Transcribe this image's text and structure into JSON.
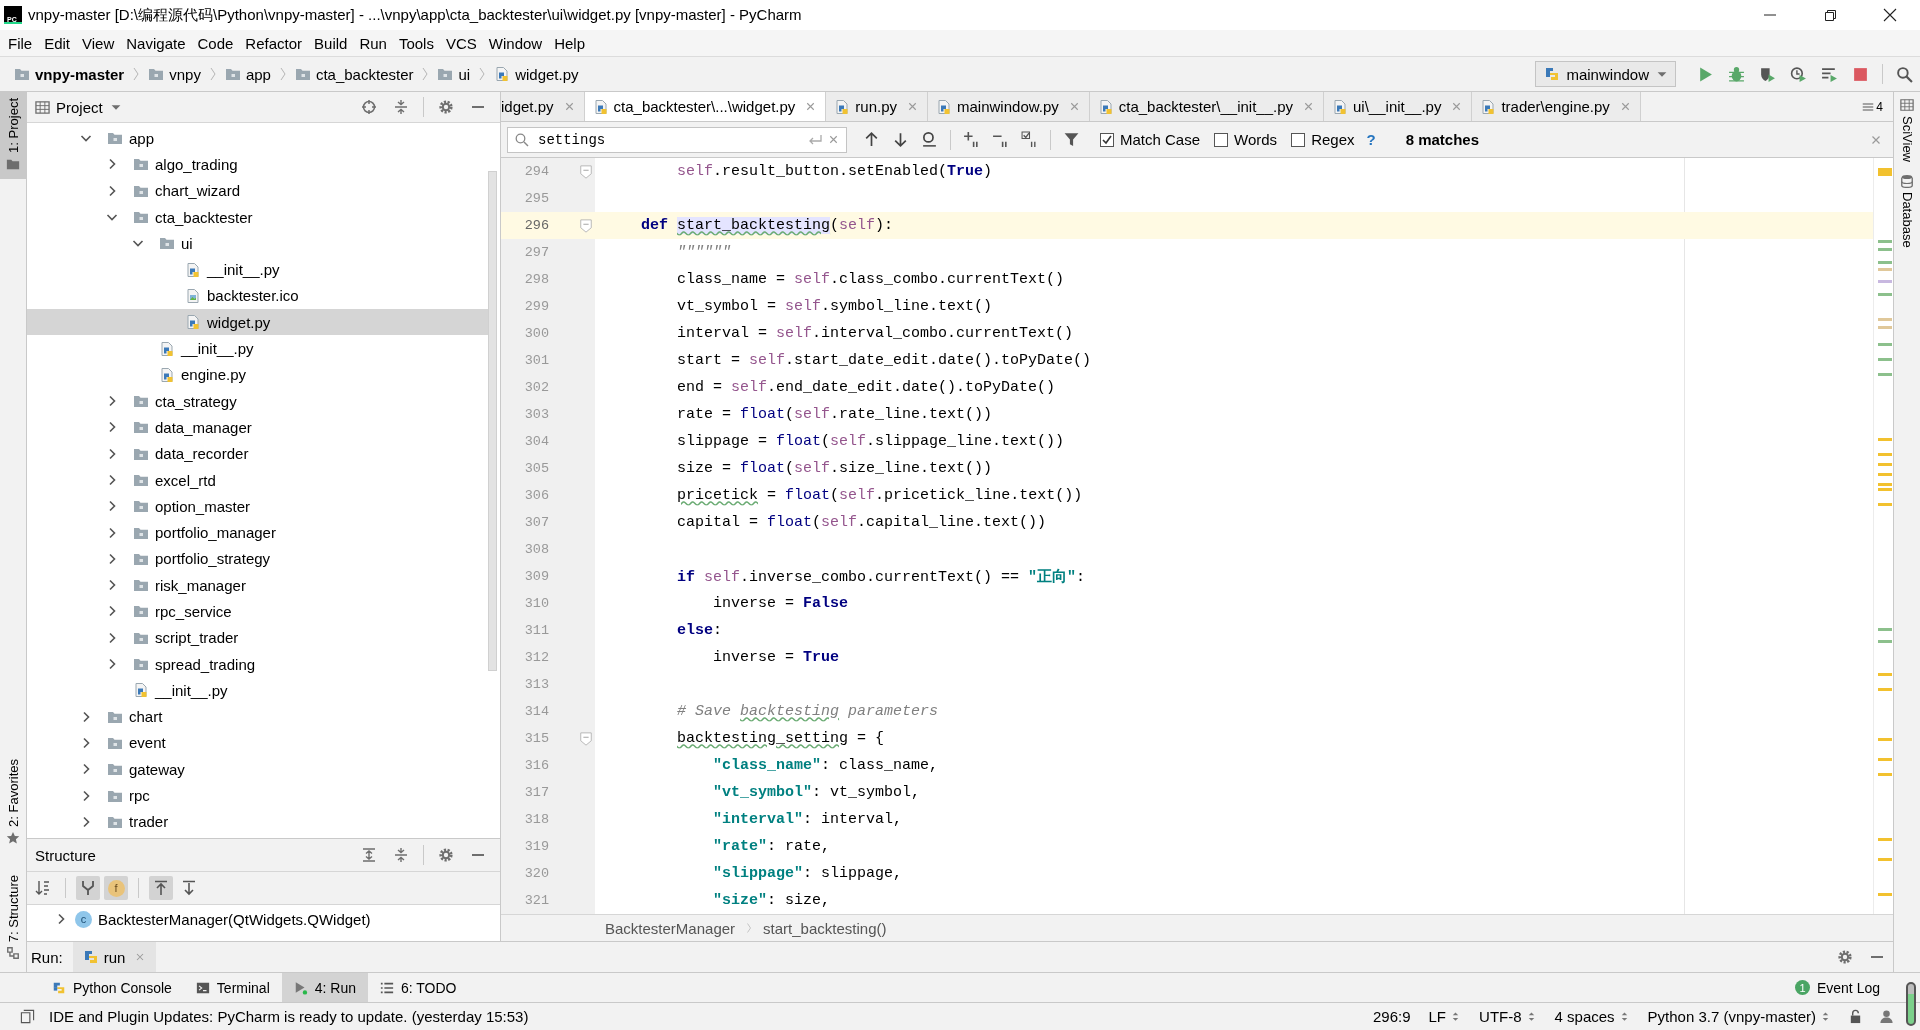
{
  "window": {
    "logo": "PC",
    "title": "vnpy-master [D:\\编程源代码\\Python\\vnpy-master] - ...\\vnpy\\app\\cta_backtester\\ui\\widget.py [vnpy-master] - PyCharm"
  },
  "menu": [
    "File",
    "Edit",
    "View",
    "Navigate",
    "Code",
    "Refactor",
    "Build",
    "Run",
    "Tools",
    "VCS",
    "Window",
    "Help"
  ],
  "breadcrumbs": [
    {
      "label": "vnpy-master",
      "kind": "root"
    },
    {
      "label": "vnpy",
      "kind": "folder"
    },
    {
      "label": "app",
      "kind": "folder"
    },
    {
      "label": "cta_backtester",
      "kind": "folder"
    },
    {
      "label": "ui",
      "kind": "folder"
    },
    {
      "label": "widget.py",
      "kind": "python"
    }
  ],
  "run_config": {
    "label": "mainwindow"
  },
  "left_tool_tabs": [
    {
      "label": "1: Project",
      "kind": "project",
      "selected": true
    },
    {
      "label": "2: Favorites",
      "kind": "favorites",
      "selected": false
    },
    {
      "label": "7: Structure",
      "kind": "structure",
      "selected": false
    }
  ],
  "right_tool_tabs": [
    {
      "label": "SciView",
      "kind": "sciview"
    },
    {
      "label": "Database",
      "kind": "database"
    }
  ],
  "project_panel": {
    "title": "Project",
    "tree": [
      {
        "label": "app",
        "kind": "folder",
        "expanded": true,
        "selected": false,
        "children": [
          {
            "label": "algo_trading",
            "kind": "folder",
            "expanded": false,
            "selected": false
          },
          {
            "label": "chart_wizard",
            "kind": "folder",
            "expanded": false,
            "selected": false
          },
          {
            "label": "cta_backtester",
            "kind": "folder",
            "expanded": true,
            "selected": false,
            "children": [
              {
                "label": "ui",
                "kind": "folder",
                "expanded": true,
                "selected": false,
                "children": [
                  {
                    "label": "__init__.py",
                    "kind": "python",
                    "selected": false
                  },
                  {
                    "label": "backtester.ico",
                    "kind": "image",
                    "selected": false
                  },
                  {
                    "label": "widget.py",
                    "kind": "python",
                    "selected": true
                  }
                ]
              },
              {
                "label": "__init__.py",
                "kind": "python",
                "selected": false
              },
              {
                "label": "engine.py",
                "kind": "python",
                "selected": false
              }
            ]
          },
          {
            "label": "cta_strategy",
            "kind": "folder",
            "expanded": false,
            "selected": false
          },
          {
            "label": "data_manager",
            "kind": "folder",
            "expanded": false,
            "selected": false
          },
          {
            "label": "data_recorder",
            "kind": "folder",
            "expanded": false,
            "selected": false
          },
          {
            "label": "excel_rtd",
            "kind": "folder",
            "expanded": false,
            "selected": false
          },
          {
            "label": "option_master",
            "kind": "folder",
            "expanded": false,
            "selected": false
          },
          {
            "label": "portfolio_manager",
            "kind": "folder",
            "expanded": false,
            "selected": false
          },
          {
            "label": "portfolio_strategy",
            "kind": "folder",
            "expanded": false,
            "selected": false
          },
          {
            "label": "risk_manager",
            "kind": "folder",
            "expanded": false,
            "selected": false
          },
          {
            "label": "rpc_service",
            "kind": "folder",
            "expanded": false,
            "selected": false
          },
          {
            "label": "script_trader",
            "kind": "folder",
            "expanded": false,
            "selected": false
          },
          {
            "label": "spread_trading",
            "kind": "folder",
            "expanded": false,
            "selected": false
          },
          {
            "label": "__init__.py",
            "kind": "python",
            "selected": false
          }
        ]
      },
      {
        "label": "chart",
        "kind": "folder",
        "expanded": false,
        "selected": false
      },
      {
        "label": "event",
        "kind": "folder",
        "expanded": false,
        "selected": false
      },
      {
        "label": "gateway",
        "kind": "folder",
        "expanded": false,
        "selected": false
      },
      {
        "label": "rpc",
        "kind": "folder",
        "expanded": false,
        "selected": false
      },
      {
        "label": "trader",
        "kind": "folder",
        "expanded": false,
        "selected": false
      }
    ]
  },
  "structure_panel": {
    "title": "Structure",
    "toolbar": [
      {
        "kind": "sort",
        "on": false
      },
      {
        "kind": "inherited",
        "on": true
      },
      {
        "kind": "fields",
        "label": "f",
        "on": true
      },
      {
        "kind": "scroll_from",
        "on": true
      },
      {
        "kind": "scroll_to",
        "on": false
      }
    ],
    "items": [
      {
        "label": "BacktesterManager(QtWidgets.QWidget)",
        "badge": "c",
        "expanded": false
      }
    ]
  },
  "editor": {
    "tabs": [
      {
        "label": "idget.py",
        "selected": false
      },
      {
        "label": "cta_backtester\\...\\widget.py",
        "kind": "python",
        "selected": true
      },
      {
        "label": "run.py",
        "kind": "python",
        "selected": false
      },
      {
        "label": "mainwindow.py",
        "kind": "python",
        "selected": false
      },
      {
        "label": "cta_backtester\\__init__.py",
        "kind": "python",
        "selected": false
      },
      {
        "label": "ui\\__init__.py",
        "kind": "python",
        "selected": false
      },
      {
        "label": "trader\\engine.py",
        "kind": "python",
        "selected": false
      }
    ],
    "tab_overflow": "4",
    "find": {
      "value": "settings",
      "options": [
        {
          "label": "Match Case",
          "checked": true
        },
        {
          "label": "Words",
          "checked": false
        },
        {
          "label": "Regex",
          "checked": false
        }
      ],
      "help": "?",
      "matches": "8 matches"
    },
    "lines": [
      {
        "number": "294",
        "current": false,
        "fold": true,
        "tokens": [
          {
            "text": "        self",
            "kind": "self"
          },
          {
            "text": ".result_button.setEnabled(",
            "kind": "t"
          },
          {
            "text": "True",
            "kind": "kw"
          },
          {
            "text": ")",
            "kind": "t"
          }
        ]
      },
      {
        "number": "295",
        "current": false,
        "fold": false
      },
      {
        "number": "296",
        "current": true,
        "fold": true,
        "tokens": [
          {
            "text": "    def ",
            "kind": "kw"
          },
          {
            "text": "start_backtesting",
            "kind": "hl"
          },
          {
            "text": "(",
            "kind": "t"
          },
          {
            "text": "self",
            "kind": "self"
          },
          {
            "text": "):",
            "kind": "t"
          }
        ]
      },
      {
        "number": "297",
        "current": false,
        "fold": false,
        "tokens": [
          {
            "text": "        \"\"\"\"\"\"",
            "kind": "doc"
          }
        ]
      },
      {
        "number": "298",
        "current": false,
        "fold": false,
        "tokens": [
          {
            "text": "        class_name = ",
            "kind": "t"
          },
          {
            "text": "self",
            "kind": "self"
          },
          {
            "text": ".class_combo.currentText()",
            "kind": "t"
          }
        ]
      },
      {
        "number": "299",
        "current": false,
        "fold": false,
        "tokens": [
          {
            "text": "        vt_symbol = ",
            "kind": "t"
          },
          {
            "text": "self",
            "kind": "self"
          },
          {
            "text": ".symbol_line.text()",
            "kind": "t"
          }
        ]
      },
      {
        "number": "300",
        "current": false,
        "fold": false,
        "tokens": [
          {
            "text": "        interval = ",
            "kind": "t"
          },
          {
            "text": "self",
            "kind": "self"
          },
          {
            "text": ".interval_combo.currentText()",
            "kind": "t"
          }
        ]
      },
      {
        "number": "301",
        "current": false,
        "fold": false,
        "tokens": [
          {
            "text": "        start = ",
            "kind": "t"
          },
          {
            "text": "self",
            "kind": "self"
          },
          {
            "text": ".start_date_edit.date().toPyDate()",
            "kind": "t"
          }
        ]
      },
      {
        "number": "302",
        "current": false,
        "fold": false,
        "tokens": [
          {
            "text": "        end = ",
            "kind": "t"
          },
          {
            "text": "self",
            "kind": "self"
          },
          {
            "text": ".end_date_edit.date().toPyDate()",
            "kind": "t"
          }
        ]
      },
      {
        "number": "303",
        "current": false,
        "fold": false,
        "tokens": [
          {
            "text": "        rate = ",
            "kind": "t"
          },
          {
            "text": "float",
            "kind": "bi"
          },
          {
            "text": "(",
            "kind": "t"
          },
          {
            "text": "self",
            "kind": "self"
          },
          {
            "text": ".rate_line.text())",
            "kind": "t"
          }
        ]
      },
      {
        "number": "304",
        "current": false,
        "fold": false,
        "tokens": [
          {
            "text": "        slippage = ",
            "kind": "t"
          },
          {
            "text": "float",
            "kind": "bi"
          },
          {
            "text": "(",
            "kind": "t"
          },
          {
            "text": "self",
            "kind": "self"
          },
          {
            "text": ".slippage_line.text())",
            "kind": "t"
          }
        ]
      },
      {
        "number": "305",
        "current": false,
        "fold": false,
        "tokens": [
          {
            "text": "        size = ",
            "kind": "t"
          },
          {
            "text": "float",
            "kind": "bi"
          },
          {
            "text": "(",
            "kind": "t"
          },
          {
            "text": "self",
            "kind": "self"
          },
          {
            "text": ".size_line.text())",
            "kind": "t"
          }
        ]
      },
      {
        "number": "306",
        "current": false,
        "fold": false,
        "tokens": [
          {
            "text": "        pricetick",
            "kind": "typo"
          },
          {
            "text": " = ",
            "kind": "t"
          },
          {
            "text": "float",
            "kind": "bi"
          },
          {
            "text": "(",
            "kind": "t"
          },
          {
            "text": "self",
            "kind": "self"
          },
          {
            "text": ".pricetick_line.text())",
            "kind": "t"
          }
        ]
      },
      {
        "number": "307",
        "current": false,
        "fold": false,
        "tokens": [
          {
            "text": "        capital = ",
            "kind": "t"
          },
          {
            "text": "float",
            "kind": "bi"
          },
          {
            "text": "(",
            "kind": "t"
          },
          {
            "text": "self",
            "kind": "self"
          },
          {
            "text": ".capital_line.text())",
            "kind": "t"
          }
        ]
      },
      {
        "number": "308",
        "current": false,
        "fold": false
      },
      {
        "number": "309",
        "current": false,
        "fold": false,
        "tokens": [
          {
            "text": "        if ",
            "kind": "kw"
          },
          {
            "text": "self",
            "kind": "self"
          },
          {
            "text": ".inverse_combo.currentText() == ",
            "kind": "t"
          },
          {
            "text": "\"正向\"",
            "kind": "str"
          },
          {
            "text": ":",
            "kind": "t"
          }
        ]
      },
      {
        "number": "310",
        "current": false,
        "fold": false,
        "tokens": [
          {
            "text": "            inverse = ",
            "kind": "t"
          },
          {
            "text": "False",
            "kind": "kw"
          }
        ]
      },
      {
        "number": "311",
        "current": false,
        "fold": false,
        "tokens": [
          {
            "text": "        else",
            "kind": "kw"
          },
          {
            "text": ":",
            "kind": "t"
          }
        ]
      },
      {
        "number": "312",
        "current": false,
        "fold": false,
        "tokens": [
          {
            "text": "            inverse = ",
            "kind": "t"
          },
          {
            "text": "True",
            "kind": "kw"
          }
        ]
      },
      {
        "number": "313",
        "current": false,
        "fold": false
      },
      {
        "number": "314",
        "current": false,
        "fold": false,
        "tokens": [
          {
            "text": "        # Save ",
            "kind": "cm"
          },
          {
            "text": "backtesting",
            "kind": "cmtypo"
          },
          {
            "text": " parameters",
            "kind": "cm"
          }
        ]
      },
      {
        "number": "315",
        "current": false,
        "fold": true,
        "tokens": [
          {
            "text": "        backtesting_setting",
            "kind": "typo"
          },
          {
            "text": " = {",
            "kind": "t"
          }
        ]
      },
      {
        "number": "316",
        "current": false,
        "fold": false,
        "tokens": [
          {
            "text": "            \"class_name\"",
            "kind": "str"
          },
          {
            "text": ": class_name,",
            "kind": "t"
          }
        ]
      },
      {
        "number": "317",
        "current": false,
        "fold": false,
        "tokens": [
          {
            "text": "            \"vt_symbol\"",
            "kind": "str"
          },
          {
            "text": ": vt_symbol,",
            "kind": "t"
          }
        ]
      },
      {
        "number": "318",
        "current": false,
        "fold": false,
        "tokens": [
          {
            "text": "            \"interval\"",
            "kind": "str"
          },
          {
            "text": ": interval,",
            "kind": "t"
          }
        ]
      },
      {
        "number": "319",
        "current": false,
        "fold": false,
        "tokens": [
          {
            "text": "            \"rate\"",
            "kind": "str"
          },
          {
            "text": ": rate,",
            "kind": "t"
          }
        ]
      },
      {
        "number": "320",
        "current": false,
        "fold": false,
        "tokens": [
          {
            "text": "            \"slippage\"",
            "kind": "str"
          },
          {
            "text": ": slippage,",
            "kind": "t"
          }
        ]
      },
      {
        "number": "321",
        "current": false,
        "fold": false,
        "tokens": [
          {
            "text": "            \"size\"",
            "kind": "str"
          },
          {
            "text": ": size,",
            "kind": "t"
          }
        ]
      }
    ],
    "breadcrumbs": [
      "BacktesterManager",
      "start_backtesting()"
    ]
  },
  "run_panel": {
    "label": "Run:",
    "tabs": [
      {
        "label": "run"
      }
    ]
  },
  "bottom_tool_tabs": [
    {
      "label": "Python Console",
      "kind": "python",
      "selected": false
    },
    {
      "label": "Terminal",
      "kind": "terminal",
      "selected": false
    },
    {
      "label": "4: Run",
      "kind": "run",
      "selected": true
    },
    {
      "label": "6: TODO",
      "kind": "todo",
      "selected": false
    }
  ],
  "event_log": {
    "label": "Event Log",
    "count": "1"
  },
  "status_bar": {
    "message": "IDE and Plugin Updates: PyCharm is ready to update. (yesterday 15:53)",
    "items": [
      {
        "label": "296:9",
        "kind": "position"
      },
      {
        "label": "LF",
        "kind": "selector"
      },
      {
        "label": "UTF-8",
        "kind": "selector"
      },
      {
        "label": "4 spaces",
        "kind": "selector"
      },
      {
        "label": "Python 3.7 (vnpy-master)",
        "kind": "selector"
      }
    ]
  }
}
